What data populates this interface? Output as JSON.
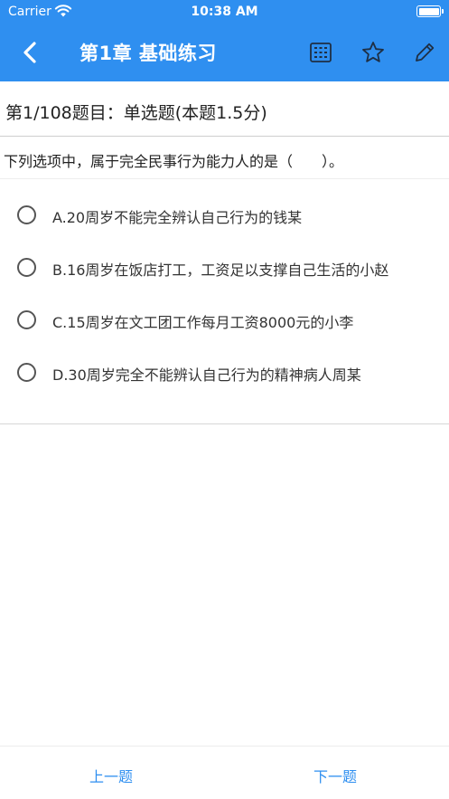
{
  "status_bar": {
    "carrier": "Carrier",
    "time": "10:38 AM"
  },
  "nav": {
    "title": "第1章 基础练习",
    "back_icon": "chevron-left-icon",
    "grid_icon": "answer-sheet-grid-icon",
    "star_icon": "star-outline-icon",
    "edit_icon": "pencil-icon"
  },
  "question": {
    "info": "第1/108题目：单选题(本题1.5分)",
    "stem": "下列选项中，属于完全民事行为能力人的是（　　）。",
    "options": [
      {
        "label": "A.20周岁不能完全辨认自己行为的钱某"
      },
      {
        "label": "B.16周岁在饭店打工，工资足以支撑自己生活的小赵"
      },
      {
        "label": "C.15周岁在文工团工作每月工资8000元的小李"
      },
      {
        "label": "D.30周岁完全不能辨认自己行为的精神病人周某"
      }
    ]
  },
  "footer": {
    "prev_label": "上一题",
    "next_label": "下一题"
  },
  "colors": {
    "primary": "#2f8ff0",
    "text": "#222222",
    "divider": "#cfcfcf"
  }
}
